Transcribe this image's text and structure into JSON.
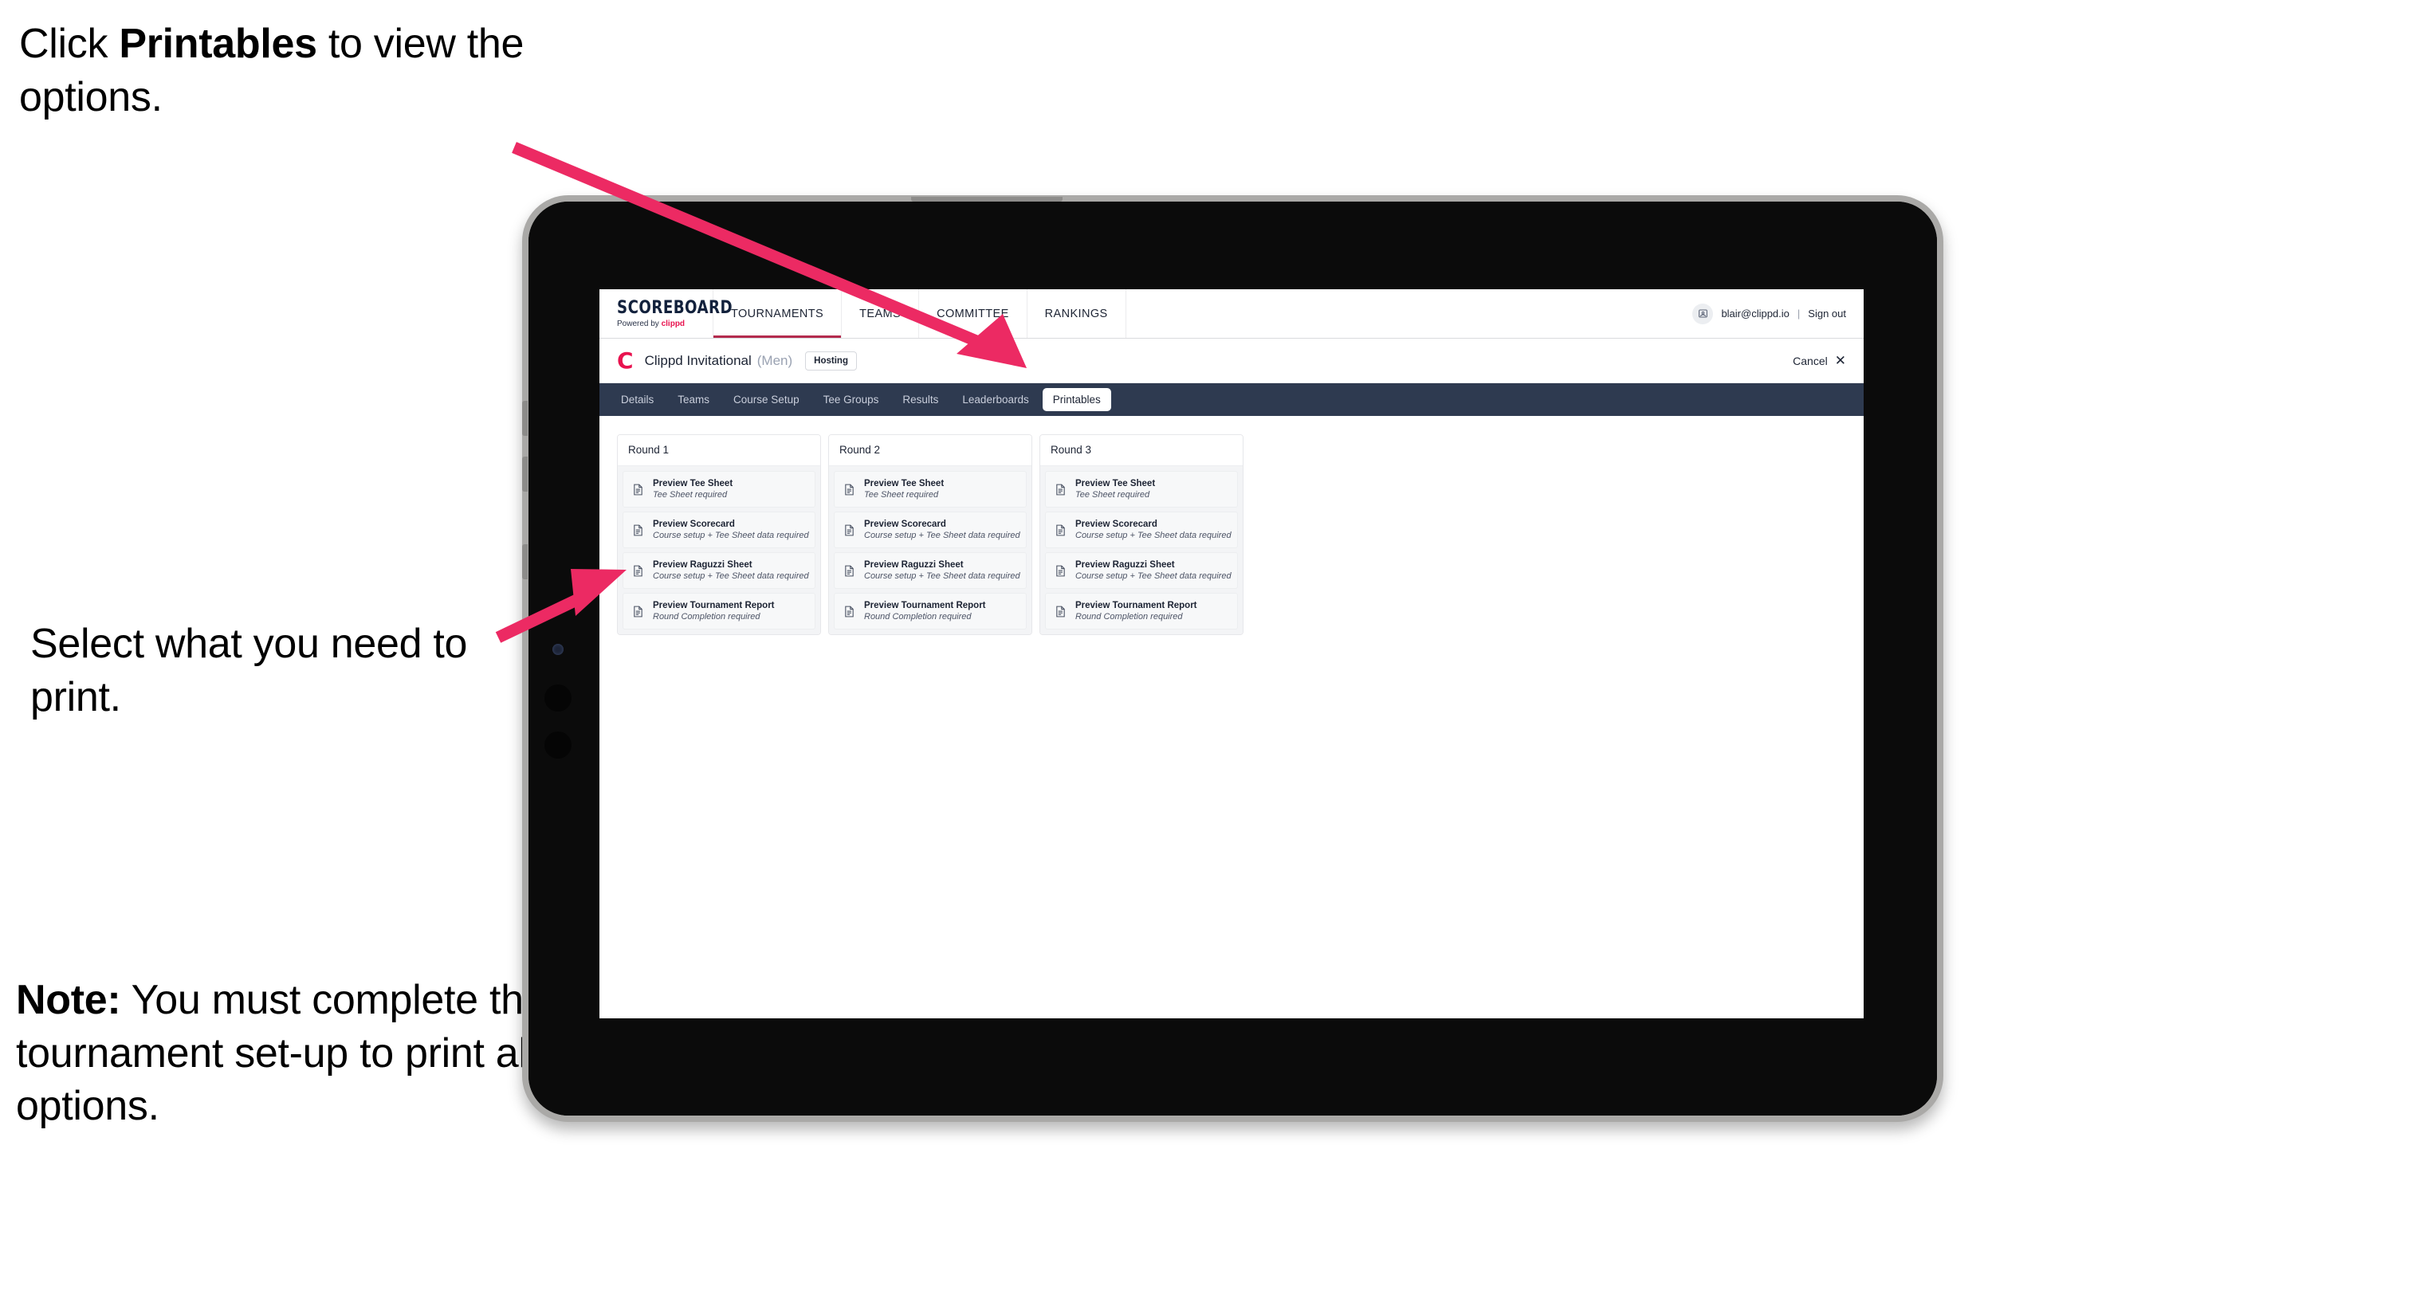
{
  "annotations": [
    {
      "id": "annot-1",
      "prefix": "Click ",
      "bold": "Printables",
      "suffix": " to view the options."
    },
    {
      "id": "annot-2",
      "prefix": "",
      "bold": "",
      "suffix": "Select what you need to print."
    },
    {
      "id": "annot-3",
      "prefix": "",
      "bold": "Note:",
      "suffix": " You must complete the tournament set-up to print all the options."
    }
  ],
  "annotation_text": {
    "line1_pre": "Click ",
    "line1_bold": "Printables",
    "line1_post": " to view the options.",
    "line2": "Select what you need to print.",
    "line3_bold": "Note:",
    "line3_post": " You must complete the tournament set-up to print all the options."
  },
  "colors": {
    "accent_pink": "#e8134f",
    "arrow_pink": "#ec2a63",
    "tabbar_navy": "#2e3a50",
    "nav_underline": "#b42b4e",
    "card_bg": "#f3f4f6"
  },
  "app": {
    "brand": {
      "title": "SCOREBOARD",
      "tagline_pre": "Powered by ",
      "tagline_brand": "clippd"
    },
    "nav": [
      {
        "label": "TOURNAMENTS",
        "active": true
      },
      {
        "label": "TEAMS",
        "active": false
      },
      {
        "label": "COMMITTEE",
        "active": false
      },
      {
        "label": "RANKINGS",
        "active": false
      }
    ],
    "account": {
      "avatar_icon": "user-avatar-icon",
      "email": "blair@clippd.io",
      "separator": "|",
      "sign_out": "Sign out"
    },
    "tournament": {
      "logo": "C",
      "name": "Clippd Invitational",
      "gender": "(Men)",
      "status_badge": "Hosting",
      "cancel_label": "Cancel",
      "cancel_icon": "close-icon"
    },
    "tabs": [
      {
        "label": "Details",
        "active": false
      },
      {
        "label": "Teams",
        "active": false
      },
      {
        "label": "Course Setup",
        "active": false
      },
      {
        "label": "Tee Groups",
        "active": false
      },
      {
        "label": "Results",
        "active": false
      },
      {
        "label": "Leaderboards",
        "active": false
      },
      {
        "label": "Printables",
        "active": true
      }
    ],
    "rounds": [
      {
        "title": "Round 1",
        "items": [
          {
            "title": "Preview Tee Sheet",
            "subtitle": "Tee Sheet required",
            "icon": "document-icon"
          },
          {
            "title": "Preview Scorecard",
            "subtitle": "Course setup + Tee Sheet data required",
            "icon": "document-icon"
          },
          {
            "title": "Preview Raguzzi Sheet",
            "subtitle": "Course setup + Tee Sheet data required",
            "icon": "document-icon"
          },
          {
            "title": "Preview Tournament Report",
            "subtitle": "Round Completion required",
            "icon": "document-icon"
          }
        ]
      },
      {
        "title": "Round 2",
        "items": [
          {
            "title": "Preview Tee Sheet",
            "subtitle": "Tee Sheet required",
            "icon": "document-icon"
          },
          {
            "title": "Preview Scorecard",
            "subtitle": "Course setup + Tee Sheet data required",
            "icon": "document-icon"
          },
          {
            "title": "Preview Raguzzi Sheet",
            "subtitle": "Course setup + Tee Sheet data required",
            "icon": "document-icon"
          },
          {
            "title": "Preview Tournament Report",
            "subtitle": "Round Completion required",
            "icon": "document-icon"
          }
        ]
      },
      {
        "title": "Round 3",
        "items": [
          {
            "title": "Preview Tee Sheet",
            "subtitle": "Tee Sheet required",
            "icon": "document-icon"
          },
          {
            "title": "Preview Scorecard",
            "subtitle": "Course setup + Tee Sheet data required",
            "icon": "document-icon"
          },
          {
            "title": "Preview Raguzzi Sheet",
            "subtitle": "Course setup + Tee Sheet data required",
            "icon": "document-icon"
          },
          {
            "title": "Preview Tournament Report",
            "subtitle": "Round Completion required",
            "icon": "document-icon"
          }
        ]
      }
    ]
  }
}
